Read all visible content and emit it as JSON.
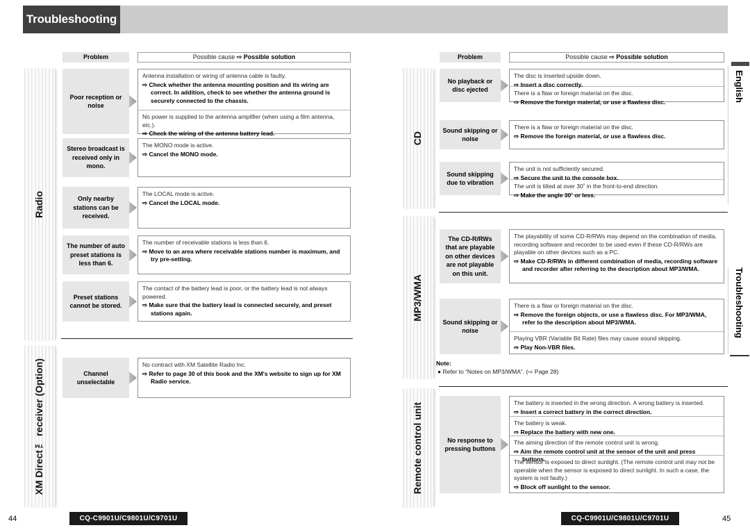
{
  "header": {
    "title": "Troubleshooting"
  },
  "side_tabs": {
    "english": "English",
    "troubleshooting": "Troubleshooting"
  },
  "table_head": {
    "problem": "Problem",
    "cause_prefix": "Possible cause",
    "arrow": "⇨",
    "solution": "Possible solution"
  },
  "arrow": "⇨",
  "left_page": {
    "page_number": "44",
    "model": "CQ-C9901U/C9801U/C9701U",
    "groups": [
      {
        "label": "Radio",
        "rows": [
          {
            "problem": "Poor reception or noise",
            "cells": [
              {
                "cause": "Antenna installation or wiring of antenna cable is faulty.",
                "solution": "Check whether the antenna mounting position and its wiring are correct. In addition, check to see whether the antenna ground is securely connected to the chassis."
              },
              {
                "cause": "No power is supplied to the antenna amplifier (when using a film antenna, etc.).",
                "solution": "Check the wiring of the antenna battery lead."
              }
            ]
          },
          {
            "problem": "Stereo broadcast is received only in mono.",
            "cells": [
              {
                "cause": "The MONO mode is active.",
                "solution": "Cancel the MONO mode."
              }
            ]
          },
          {
            "problem": "Only nearby stations can be received.",
            "cells": [
              {
                "cause": "The LOCAL mode is active.",
                "solution": "Cancel the LOCAL mode."
              }
            ]
          },
          {
            "problem": "The number of auto preset stations is less than 6.",
            "cells": [
              {
                "cause": "The number of receivable stations is less than 6.",
                "solution": "Move to an area where receivable stations number is maximum, and try pre-setting."
              }
            ]
          },
          {
            "problem": "Preset stations cannot be stored.",
            "cells": [
              {
                "cause": "The contact of the battery lead is poor, or the battery lead is not always powered.",
                "solution": "Make sure that the battery lead is connected securely, and preset stations again."
              }
            ]
          }
        ]
      },
      {
        "label": "XM Direct™ receiver (Option)",
        "rows": [
          {
            "problem": "Channel unselectable",
            "cells": [
              {
                "cause": "No contract with XM Satellite Radio Inc.",
                "solution": "Refer to page 30 of this book and the XM's website to sign up for XM Radio service."
              }
            ]
          }
        ]
      }
    ]
  },
  "right_page": {
    "page_number": "45",
    "model": "CQ-C9901U/C9801U/C9701U",
    "groups": [
      {
        "label": "CD",
        "rows": [
          {
            "problem": "No playback or disc ejected",
            "cells": [
              {
                "cause": "The disc is inserted upside down.",
                "solution": "Insert a disc correctly."
              },
              {
                "cause": "There is a flaw or foreign material on the disc.",
                "solution": "Remove the foreign material, or use a flawless disc."
              }
            ]
          },
          {
            "problem": "Sound skipping or noise",
            "cells": [
              {
                "cause": "There is a flaw or foreign material on the disc.",
                "solution": "Remove the foreign material, or use a flawless disc."
              }
            ]
          },
          {
            "problem": "Sound skipping due to vibration",
            "cells": [
              {
                "cause": "The unit is not sufficiently secured.",
                "solution": "Secure the unit to the console box."
              },
              {
                "cause": "The unit is tilted at over 30˚ in the front-to-end direction.",
                "solution": "Make the angle 30˚ or less."
              }
            ]
          }
        ]
      },
      {
        "label": "MP3/WMA",
        "rows": [
          {
            "problem": "The CD-R/RWs that are playable on other devices are not playable on this unit.",
            "cells": [
              {
                "cause": "The playability of some CD-R/RWs may depend on the combination of media, recording software and recorder to be used even if these CD-R/RWs are playable on other devices such as a PC.",
                "solution": "Make CD-R/RWs in different combination of media, recording software and recorder after referring to the description about MP3/WMA."
              }
            ]
          },
          {
            "problem": "Sound skipping or noise",
            "cells": [
              {
                "cause": "There is a flaw or foreign material on the disc.",
                "solution": "Remove the foreign objects, or use a flawless disc. For MP3/WMA, refer to the description about MP3/WMA."
              },
              {
                "cause": "Playing VBR (Variable Bit Rate) files may cause sound skipping.",
                "solution": "Play Non-VBR files."
              }
            ]
          }
        ],
        "note": {
          "title": "Note:",
          "item": "● Refer to “Notes on MP3/WMA”. (⇨ Page 28)"
        }
      },
      {
        "label": "Remote control unit",
        "rows": [
          {
            "problem": "No response to pressing buttons",
            "cells": [
              {
                "cause": "The battery is inserted in the wrong direction. A wrong battery is inserted.",
                "solution": "Insert a correct battery in the correct direction."
              },
              {
                "cause": "The battery is weak.",
                "solution": "Replace the battery with new one."
              },
              {
                "cause": "The aiming direction of the remote control unit is wrong.",
                "solution": "Aim the remote control unit at the sensor of the unit and press buttons."
              },
              {
                "cause": "The sensor is exposed to direct sunlight. (The remote control unit may not be operable when the sensor is exposed to direct sunlight. In such a case, the system is not faulty.)",
                "solution": "Block off sunlight to the sensor."
              }
            ]
          }
        ]
      }
    ]
  }
}
